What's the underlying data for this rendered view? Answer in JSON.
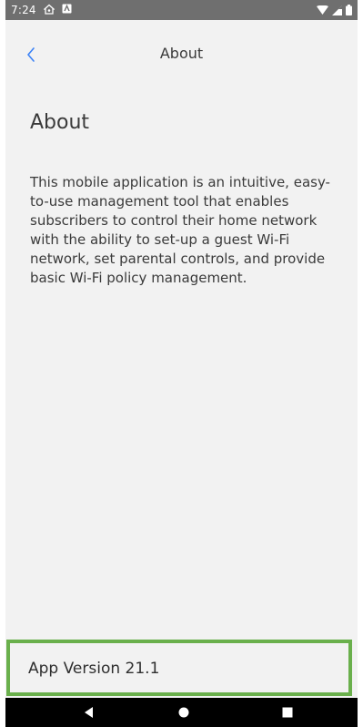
{
  "status_bar": {
    "time": "7:24",
    "icons": [
      "home-notification-icon",
      "app-notification-icon",
      "wifi-icon",
      "cellular-signal-icon",
      "battery-icon"
    ]
  },
  "app_bar": {
    "title": "About",
    "back_icon": "chevron-left-icon",
    "accent_color": "#3b82f6"
  },
  "content": {
    "heading": "About",
    "description": "This mobile application is an intuitive, easy-to-use management tool that enables subscribers to control their home network with the ability to set-up a guest Wi-Fi network, set parental controls, and provide basic Wi-Fi policy management."
  },
  "footer": {
    "version_label": "App Version 21.1",
    "highlight_color": "#6ab04c"
  },
  "nav_bar": {
    "buttons": [
      "back-triangle-icon",
      "home-circle-icon",
      "recents-square-icon"
    ]
  }
}
